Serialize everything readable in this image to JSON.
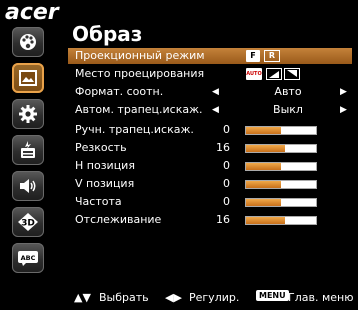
{
  "brand": {
    "logo_text": "acer"
  },
  "sidebar": {
    "items": [
      {
        "name": "color-icon",
        "active": false
      },
      {
        "name": "image-icon",
        "active": true
      },
      {
        "name": "settings-icon",
        "active": false
      },
      {
        "name": "power-icon",
        "active": false
      },
      {
        "name": "audio-icon",
        "active": false
      },
      {
        "name": "3d-icon",
        "label": "3D",
        "active": false
      },
      {
        "name": "language-icon",
        "label": "ABC",
        "active": false
      }
    ]
  },
  "menu": {
    "title": "Образ",
    "rows": [
      {
        "label": "Проекционный режим",
        "type": "icons",
        "icons": [
          "F",
          "R"
        ],
        "selected": true
      },
      {
        "label": "Место проецирования",
        "type": "icons",
        "icons": [
          "AUTO",
          "front-desk",
          "rear-ceiling"
        ],
        "selected": false
      },
      {
        "label": "Формат. соотн.",
        "type": "select",
        "value": "Авто"
      },
      {
        "label": "Автом. трапец.искаж.",
        "type": "select",
        "value": "Выкл"
      },
      {
        "label": "Ручн. трапец.искаж.",
        "type": "slider",
        "value": "0",
        "level": 0.5
      },
      {
        "label": "Резкость",
        "type": "slider",
        "value": "16",
        "level": 0.55
      },
      {
        "label": "H позиция",
        "type": "slider",
        "value": "0",
        "level": 0.5
      },
      {
        "label": "V позиция",
        "type": "slider",
        "value": "0",
        "level": 0.5
      },
      {
        "label": "Частота",
        "type": "slider",
        "value": "0",
        "level": 0.5
      },
      {
        "label": "Отслеживание",
        "type": "slider",
        "value": "16",
        "level": 0.55
      }
    ]
  },
  "footer": {
    "select_label": "Выбрать",
    "adjust_label": "Регулир.",
    "menu_key": "MENU",
    "main_menu_label": "Глав. меню"
  },
  "colors": {
    "accent": "#c4823a",
    "accent_border": "#e9a24a",
    "slider_fill": "#e39a3e"
  }
}
